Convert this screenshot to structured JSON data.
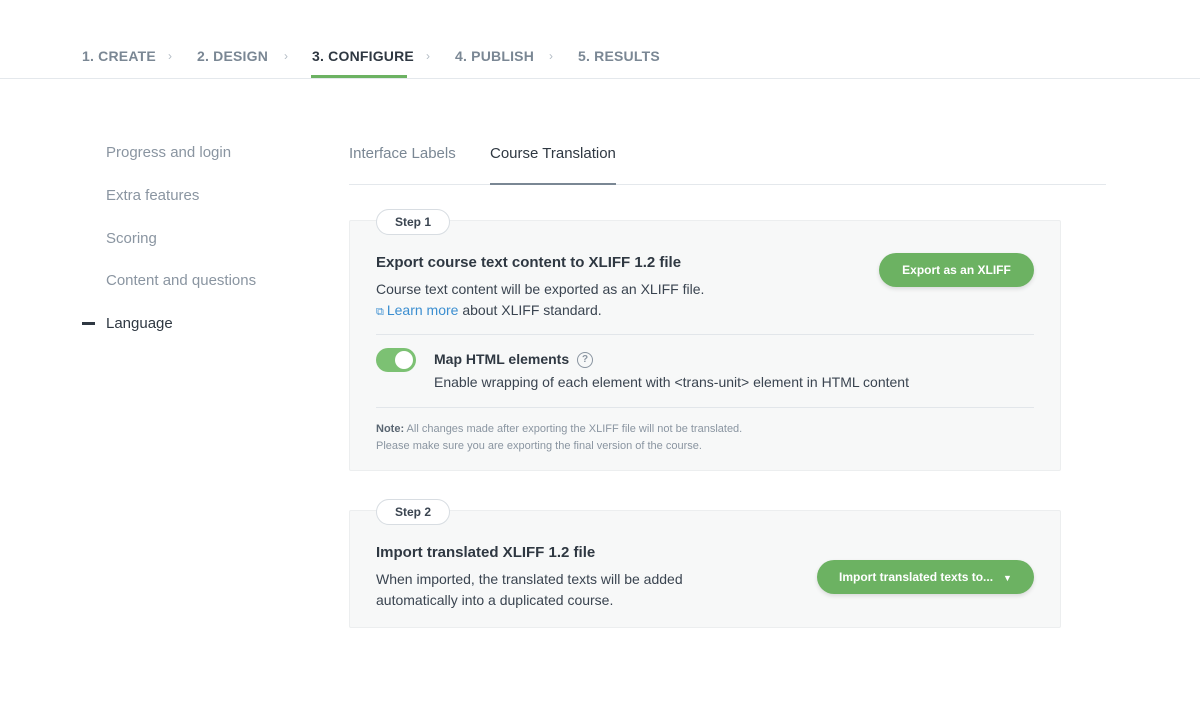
{
  "stepper": {
    "steps": [
      {
        "label": "1. CREATE"
      },
      {
        "label": "2. DESIGN"
      },
      {
        "label": "3. CONFIGURE"
      },
      {
        "label": "4. PUBLISH"
      },
      {
        "label": "5. RESULTS"
      }
    ],
    "separator": "›",
    "active_index": 2
  },
  "sidebar": {
    "items": [
      {
        "label": "Progress and login"
      },
      {
        "label": "Extra features"
      },
      {
        "label": "Scoring"
      },
      {
        "label": "Content and questions"
      },
      {
        "label": "Language"
      }
    ],
    "active_index": 4
  },
  "tabs": [
    {
      "label": "Interface Labels"
    },
    {
      "label": "Course Translation"
    }
  ],
  "step1": {
    "pill": "Step 1",
    "title": "Export course text content to XLIFF 1.2 file",
    "description": "Course text content will be exported as an XLIFF file.",
    "learn_more": "Learn more",
    "learn_more_suffix": " about XLIFF standard.",
    "export_button": "Export as an XLIFF",
    "toggle_title": "Map HTML elements",
    "toggle_on": true,
    "help": "?",
    "toggle_text": "Enable wrapping of each element with <trans-unit> element in HTML content",
    "note_label": "Note:",
    "note_line1": " All changes made after exporting the XLIFF file will not be translated.",
    "note_line2": "Please make sure you are exporting the final version of the course."
  },
  "step2": {
    "pill": "Step 2",
    "title": "Import translated XLIFF 1.2 file",
    "desc_line1": "When imported, the translated texts will be added",
    "desc_line2": "automatically into a duplicated course.",
    "import_button": "Import translated texts to..."
  },
  "colors": {
    "accent_green": "#6cb262",
    "link_blue": "#3b8ed0",
    "text_dark": "#2f3842",
    "text_muted": "#7a8794"
  }
}
